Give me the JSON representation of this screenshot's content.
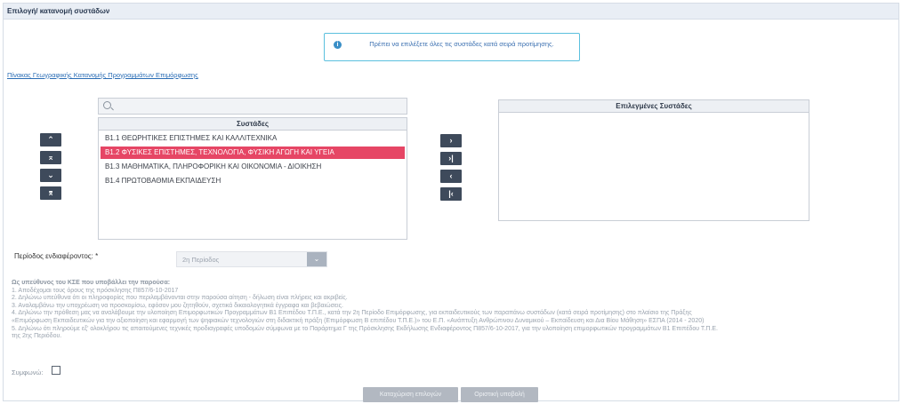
{
  "panel": {
    "title": "Επιλογή/ κατανομή συστάδων"
  },
  "info": {
    "icon": "info-icon",
    "glyph": "i",
    "message": "Πρέπει να επιλέξετε όλες τις συστάδες κατά σειρά προτίμησης."
  },
  "geo_link": "Πίνακας Γεωγραφικής Κατανομής Προγραμμάτων Επιμόρφωσης",
  "available": {
    "title": "Συστάδες",
    "items": [
      "Β1.1 ΘΕΩΡΗΤΙΚΕΣ ΕΠΙΣΤΗΜΕΣ ΚΑΙ ΚΑΛΛΙΤΕΧΝΙΚΑ",
      "Β1.2 ΦΥΣΙΚΕΣ ΕΠΙΣΤΗΜΕΣ, ΤΕΧΝΟΛΟΓΙΑ, ΦΥΣΙΚΗ ΑΓΩΓΗ ΚΑΙ ΥΓΕΙΑ",
      "Β1.3 ΜΑΘΗΜΑΤΙΚΑ, ΠΛΗΡΟΦΟΡΙΚΗ ΚΑΙ ΟΙΚΟΝΟΜΙΑ - ΔΙΟΙΚΗΣΗ",
      "Β1.4 ΠΡΩΤΟΒΑΘΜΙΑ ΕΚΠΑΙΔΕΥΣΗ"
    ],
    "selected_index": 1
  },
  "chosen": {
    "title": "Επιλεγμένες Συστάδες"
  },
  "order_buttons": {
    "up": "⌃",
    "top": "⌅",
    "down": "⌄",
    "bottom": "⌆"
  },
  "move_buttons": {
    "add": "›",
    "add_all": "›|",
    "remove": "‹",
    "remove_all": "|‹"
  },
  "period": {
    "label": "Περίοδος ενδιαφέροντος: *",
    "value": "2η Περίοδος",
    "caret": "⌄"
  },
  "declaration": {
    "title": "Ως υπεύθυνος του ΚΣΕ που υποβάλλει την παρούσα:",
    "lines": [
      "1. Αποδέχομαι τους όρους της πρόσκλησης Π857/6-10-2017",
      "2. Δηλώνω υπεύθυνα ότι οι πληροφορίες που περιλαμβάνονται στην παρούσα αίτηση - δήλωση είναι πλήρεις και ακριβείς.",
      "3. Αναλαμβάνω την υποχρέωση να προσκομίσω, εφόσον μου ζητηθούν, σχετικά δικαιολογητικά έγγραφα και βεβαιώσεις.",
      "4. Δηλώνω την πρόθεση μας να αναλάβουμε την υλοποίηση Επιμορφωτικών Προγραμμάτων Β1 Επιπέδου Τ.Π.Ε., κατά την 2η Περίοδο Επιμόρφωσης, για εκπαιδευτικούς των παραπάνω συστάδων (κατά σειρά προτίμησης) στο πλαίσιο της Πράξης",
      "«Επιμόρφωση Εκπαιδευτικών για την αξιοποίηση και εφαρμογή των ψηφιακών τεχνολογιών στη διδακτική πράξη (Επιμόρφωση Β επιπέδου Τ.Π.Ε.)» του Ε.Π. «Ανάπτυξη Ανθρώπινου Δυναμικού – Εκπαίδευση και Δια Βίου Μάθηση» ΕΣΠΑ (2014 - 2020)",
      "5. Δηλώνω ότι πληρούμε εξ' ολοκλήρου τις απαιτούμενες τεχνικές προδιαγραφές υποδομών σύμφωνα με το Παράρτημα Γ της Πρόσκλησης Εκδήλωσης Ενδιαφέροντος Π857/6-10-2017, για την υλοποίηση επιμορφωτικών προγραμμάτων Β1 Επιπέδου Τ.Π.Ε.",
      "της 2ης Περιόδου."
    ]
  },
  "agree": {
    "label": "Συμφωνώ:"
  },
  "footer": {
    "save_label": "Καταχώριση επιλογών",
    "submit_label": "Οριστική υποβολή"
  }
}
